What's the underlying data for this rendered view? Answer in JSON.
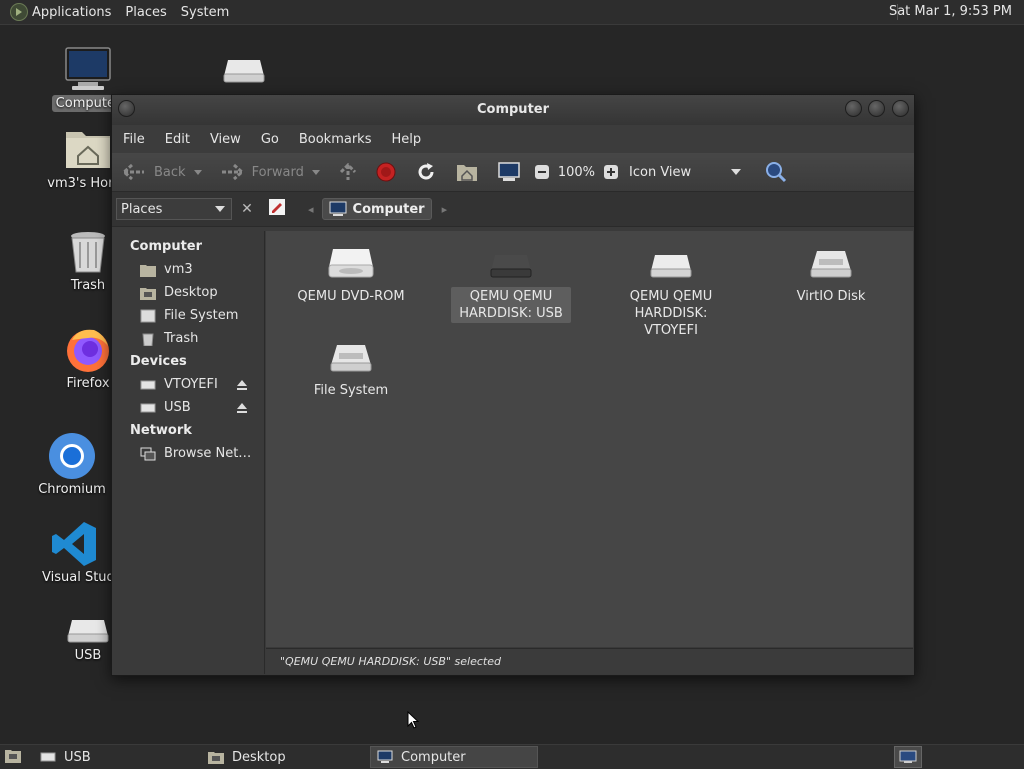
{
  "top_panel": {
    "menus": [
      "Applications",
      "Places",
      "System"
    ],
    "clock": "Sat Mar 1,  9:53 PM"
  },
  "desktop": {
    "icons": [
      {
        "label": "Computer",
        "icon": "monitor-icon",
        "selected": true
      },
      {
        "label": "",
        "icon": "drive-icon"
      },
      {
        "label": "vm3's Home",
        "icon": "home-folder-icon"
      },
      {
        "label": "Trash",
        "icon": "trash-icon"
      },
      {
        "label": "Firefox",
        "icon": "firefox-icon"
      },
      {
        "label": "Chromium",
        "icon": "chromium-icon"
      },
      {
        "label": "Visual Studio Code",
        "icon": "vscode-icon"
      },
      {
        "label": "USB",
        "icon": "drive-icon"
      }
    ]
  },
  "window": {
    "title": "Computer",
    "menus": [
      "File",
      "Edit",
      "View",
      "Go",
      "Bookmarks",
      "Help"
    ],
    "toolbar": {
      "back": "Back",
      "forward": "Forward",
      "zoom": "100%",
      "view_mode": "Icon View"
    },
    "pathbar": {
      "places_label": "Places",
      "current": "Computer"
    },
    "sidebar": {
      "sections": [
        {
          "title": "Computer",
          "items": [
            "vm3",
            "Desktop",
            "File System",
            "Trash"
          ]
        },
        {
          "title": "Devices",
          "items": [
            "VTOYEFI",
            "USB"
          ]
        },
        {
          "title": "Network",
          "items": [
            "Browse Net…"
          ]
        }
      ]
    },
    "files": [
      {
        "label": "QEMU DVD-ROM",
        "icon": "optical-drive-icon",
        "selected": false
      },
      {
        "label": "QEMU QEMU HARDDISK: USB",
        "icon": "usb-drive-icon",
        "selected": true
      },
      {
        "label": "QEMU QEMU HARDDISK: VTOYEFI",
        "icon": "harddisk-icon",
        "selected": false
      },
      {
        "label": "VirtIO Disk",
        "icon": "harddisk-icon",
        "selected": false
      },
      {
        "label": "File System",
        "icon": "harddisk-icon",
        "selected": false
      }
    ],
    "status": "\"QEMU QEMU HARDDISK: USB\" selected"
  },
  "taskbar": {
    "tasks": [
      {
        "label": "USB",
        "icon": "drive-icon",
        "active": false
      },
      {
        "label": "Desktop",
        "icon": "folder-icon",
        "active": false
      },
      {
        "label": "Computer",
        "icon": "monitor-icon",
        "active": true
      }
    ]
  },
  "colors": {
    "desktop_bg": "#262626",
    "panel_bg": "#2d2d2d",
    "window_bg": "#3a3a3a",
    "content_bg": "#464646",
    "selection": "#5e5e5e"
  }
}
